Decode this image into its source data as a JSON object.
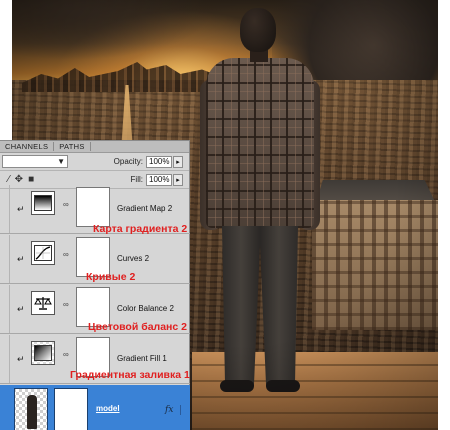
{
  "panel": {
    "tabs": [
      "CHANNELS",
      "PATHS"
    ],
    "blend_mode": "",
    "opacity_label": "Opacity:",
    "opacity_value": "100%",
    "fill_label": "Fill:",
    "fill_value": "100%"
  },
  "layers": [
    {
      "name": "Gradient Map 2",
      "annotation": "Карта градиента 2",
      "icon": "gradient-map-icon"
    },
    {
      "name": "Curves 2",
      "annotation": "Кривые 2",
      "icon": "curves-icon"
    },
    {
      "name": "Color Balance 2",
      "annotation": "Цветовой баланс 2",
      "icon": "color-balance-icon"
    },
    {
      "name": "Gradient Fill 1",
      "annotation": "Градиентная заливка 1",
      "icon": "gradient-fill-icon"
    },
    {
      "name": "model",
      "icon": "layer-thumbnail",
      "selected": true,
      "effects": "fx"
    }
  ],
  "colors": {
    "annotation": "#e02020",
    "selected_layer": "#3a82d6",
    "panel_bg": "#d6d6d6"
  }
}
